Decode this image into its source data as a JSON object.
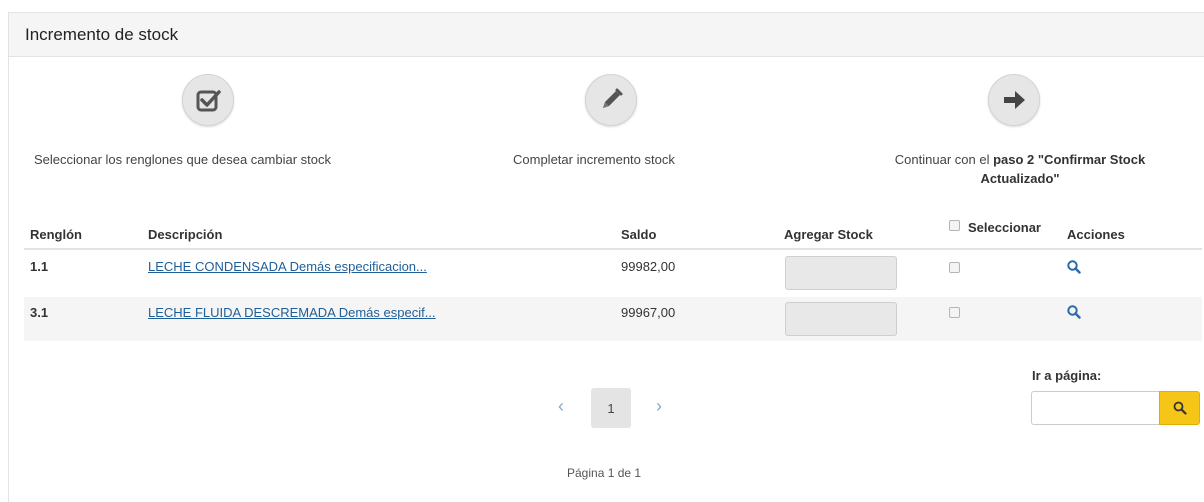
{
  "panel": {
    "title": "Incremento de stock"
  },
  "steps": [
    {
      "icon": "checkbox-icon",
      "text": "Seleccionar los renglones que desea cambiar stock"
    },
    {
      "icon": "pencil-icon",
      "text": "Completar incremento stock"
    },
    {
      "icon": "arrow-right-icon",
      "text_prefix": "Continuar con el",
      "text_bold": "paso 2 \"Confirmar Stock Actualizado\""
    }
  ],
  "table": {
    "headers": {
      "renglon": "Renglón",
      "descripcion": "Descripción",
      "saldo": "Saldo",
      "agregar_stock": "Agregar Stock",
      "seleccionar": "Seleccionar",
      "acciones": "Acciones"
    },
    "rows": [
      {
        "renglon": "1.1",
        "descripcion": "LECHE CONDENSADA Demás especificacion...",
        "saldo": "99982,00",
        "agregar_stock": ""
      },
      {
        "renglon": "3.1",
        "descripcion": "LECHE FLUIDA DESCREMADA Demás especif...",
        "saldo": "99967,00",
        "agregar_stock": ""
      }
    ]
  },
  "pagination": {
    "current_page": "1",
    "page_info": "Página 1 de 1"
  },
  "goto": {
    "label": "Ir a página:",
    "value": ""
  },
  "colors": {
    "accent_yellow": "#f5c518",
    "link_blue": "#1f5f99",
    "header_bg": "#f5f5f5"
  }
}
